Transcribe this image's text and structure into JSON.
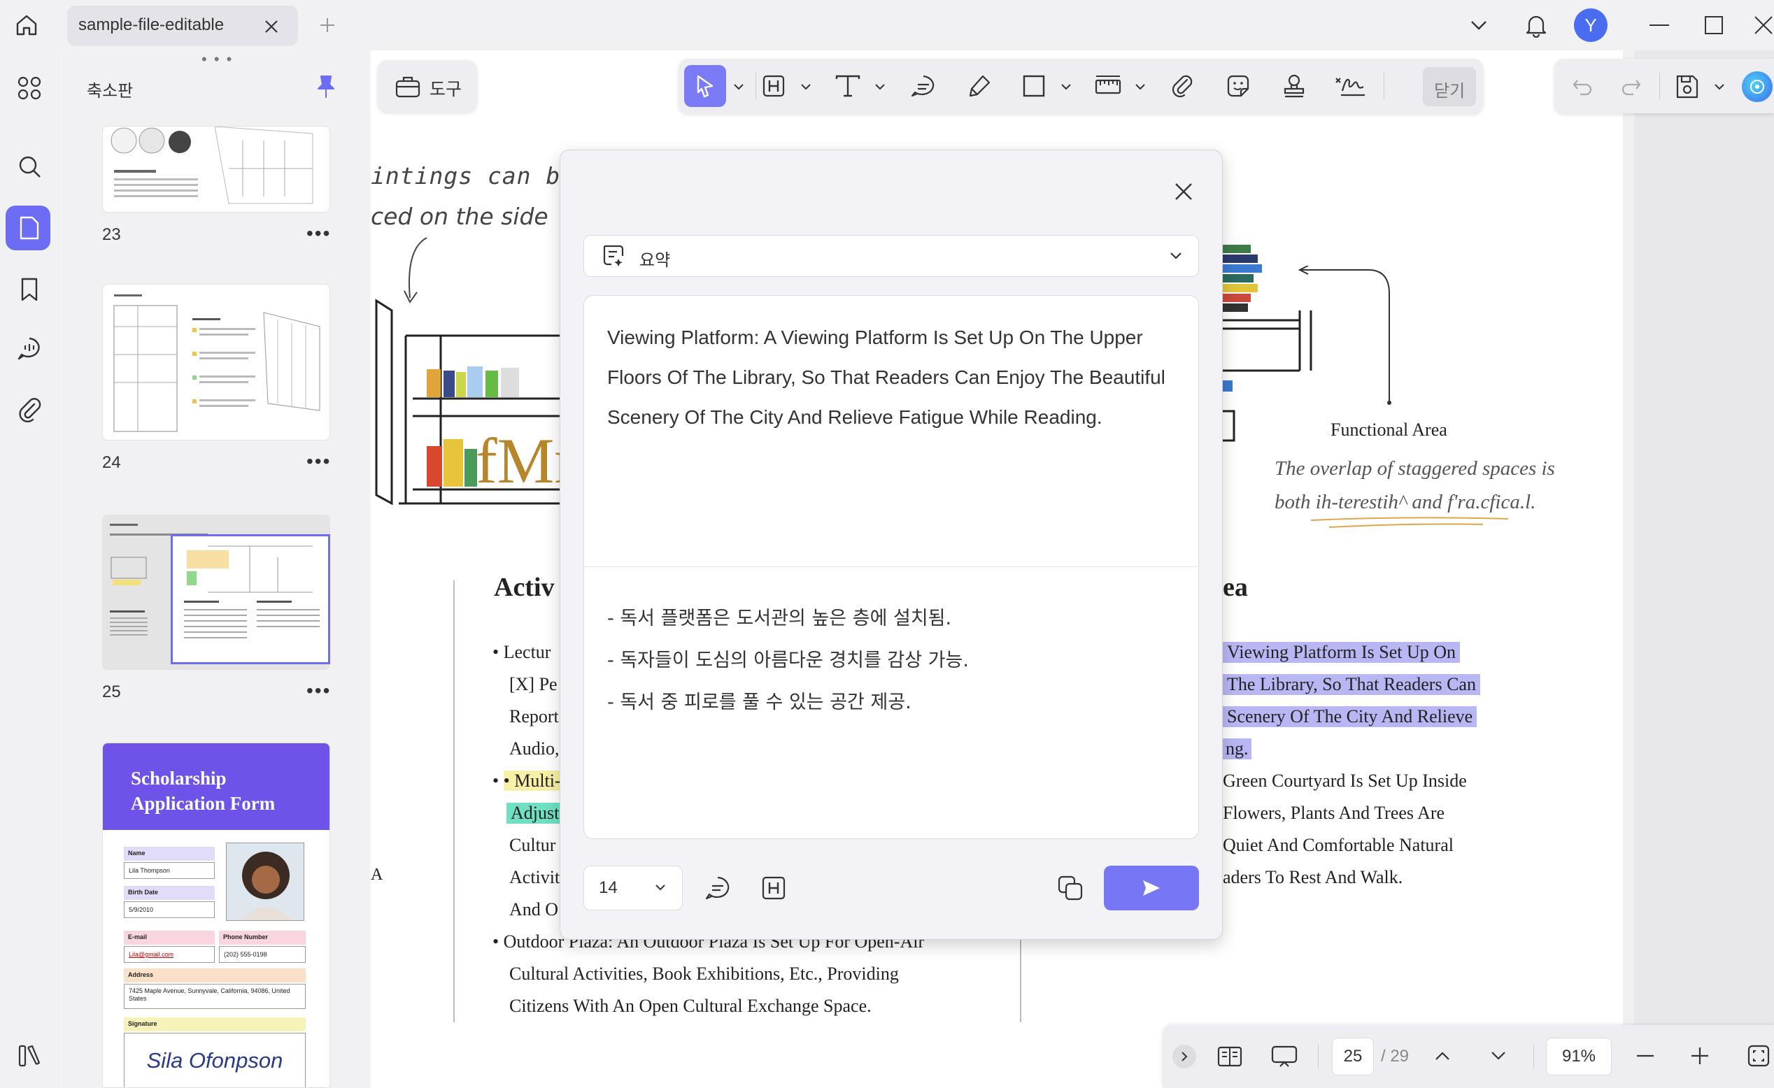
{
  "tab": {
    "title": "sample-file-editable"
  },
  "titlebar": {
    "avatar_letter": "Y"
  },
  "thumb_panel": {
    "title": "축소판",
    "pages": [
      {
        "num": "23"
      },
      {
        "num": "24"
      },
      {
        "num": "25"
      }
    ],
    "page26": {
      "banner": "Scholarship Application Form",
      "name_label": "Name",
      "name_value": "Lila Thompson",
      "birth_label": "Birth Date",
      "birth_value": "5/9/2010",
      "email_label": "E-mail",
      "email_value": "Lila@gmail.com",
      "phone_label": "Phone Number",
      "phone_value": "(202) 555-0198",
      "address_label": "Address",
      "address_value": "7425 Maple Avenue, Sunnyvale, California, 94086, United States",
      "signature_label": "Signature",
      "signature_value": "Sila Ofonpson"
    }
  },
  "toolbar": {
    "tools_button": "도구",
    "close_button": "닫기"
  },
  "document": {
    "handwritten_1": "intings can be",
    "handwritten_2": "ced on the side",
    "heading_left": "Activ",
    "heading_right": "ea",
    "functional_area": "Functional Area",
    "italic_1": "The overlap of staggered spaces is",
    "italic_2": "both ih-terestih^ and f'ra.cfica.l.",
    "left_lines": [
      "• Lectur",
      "[X] Pe",
      "Report",
      "Audio,",
      "• Multi-",
      "Adjust",
      "Cultur",
      "Activit",
      "And O",
      "• Outdoor Plaza: An Outdoor Plaza Is Set Up For Open-Air",
      "Cultural Activities, Book Exhibitions, Etc., Providing",
      "Citizens With An Open Cultural Exchange Space."
    ],
    "right_lines": [
      "Viewing Platform Is Set Up On",
      "The Library, So That Readers Can",
      "Scenery Of The City And Relieve",
      "ng.",
      "Green Courtyard Is Set Up Inside",
      "Flowers, Plants And Trees Are",
      "Quiet And Comfortable Natural",
      "aders To Rest And Walk."
    ],
    "image_text": "fMr"
  },
  "dialog": {
    "mode": "요약",
    "source_text": "Viewing Platform: A Viewing Platform Is Set Up On The Upper Floors Of The Library, So That Readers Can Enjoy The Beautiful Scenery Of The City And Relieve Fatigue While Reading.",
    "summary": [
      "- 독서 플랫폼은 도서관의 높은 층에 설치됨.",
      "- 독자들이 도심의 아름다운 경치를 감상 가능.",
      "- 독서 중 피로를 풀 수 있는 공간 제공."
    ],
    "font_size": "14"
  },
  "bottombar": {
    "current_page": "25",
    "total_pages": "/ 29",
    "zoom": "91%"
  },
  "colors": {
    "accent": "#7777f6",
    "highlight_blue": "#b9b6f4",
    "highlight_green": "#6fe0c2",
    "highlight_yellow": "#f7f0a6"
  }
}
